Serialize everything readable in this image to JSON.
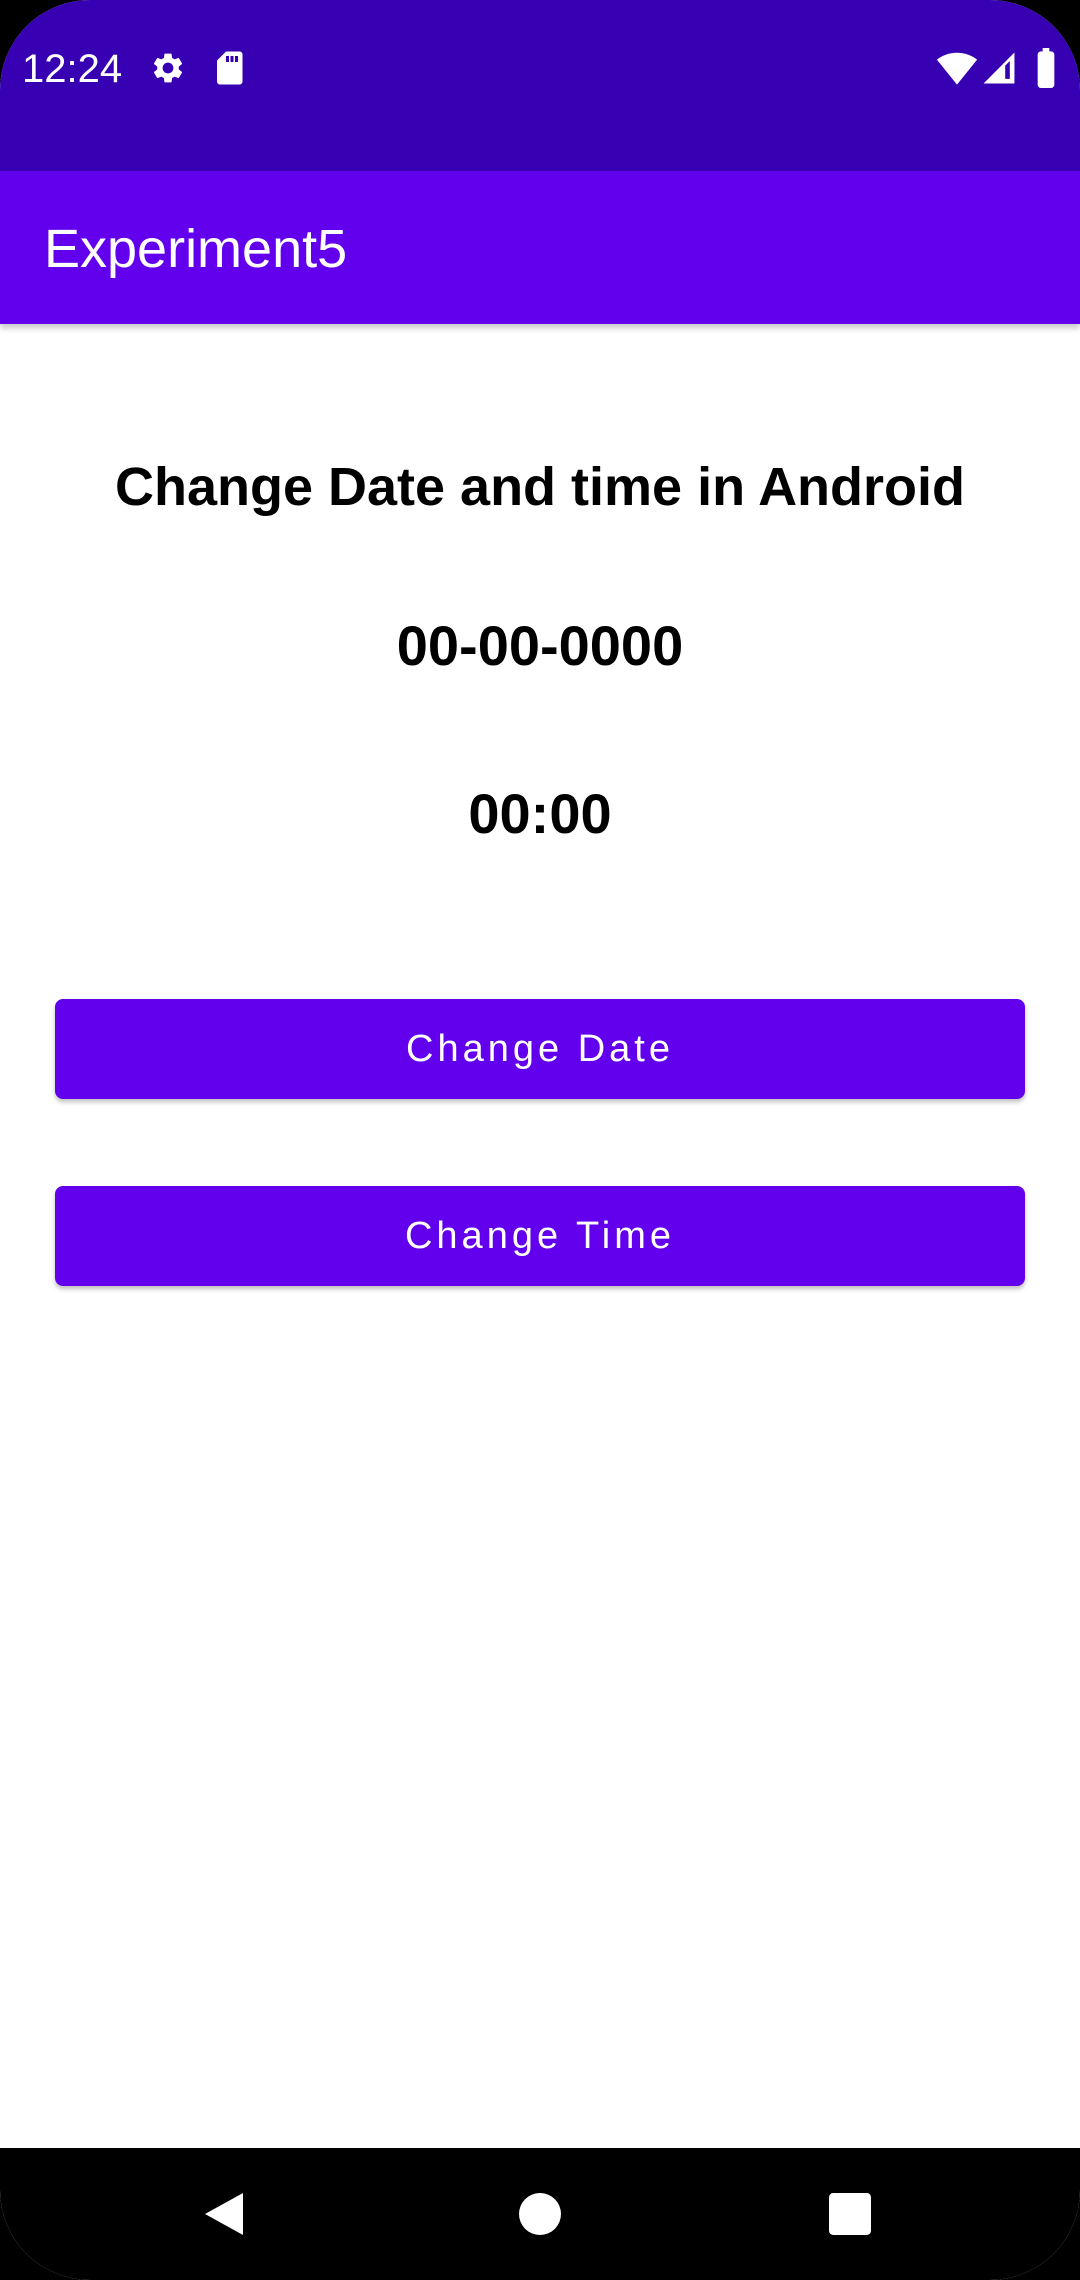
{
  "status_bar": {
    "time": "12:24",
    "icons": [
      "settings-icon",
      "sd-card-icon",
      "wifi-icon",
      "cellular-signal-icon",
      "battery-icon"
    ],
    "background": "#3700B3"
  },
  "app_bar": {
    "title": "Experiment5",
    "background": "#6200EE"
  },
  "main": {
    "heading": "Change Date and time in Android",
    "date_value": "00-00-0000",
    "time_value": "00:00",
    "change_date_button": "Change Date",
    "change_time_button": "Change Time",
    "button_color": "#6200EE"
  },
  "nav_bar": {
    "icons": [
      "back-icon",
      "home-icon",
      "recents-icon"
    ]
  }
}
